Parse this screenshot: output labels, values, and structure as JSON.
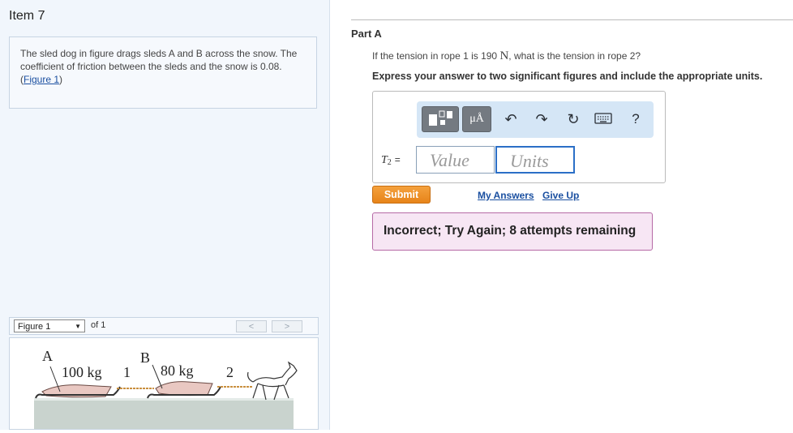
{
  "item": {
    "title": "Item 7"
  },
  "problem": {
    "text": "The sled dog in figure drags sleds A and B across the snow. The coefficient of friction between the sleds and the snow is 0.08.",
    "figure_link_open": "(",
    "figure_link": "Figure 1",
    "figure_link_close": ")"
  },
  "figure_nav": {
    "selected": "Figure 1",
    "of_label": "of 1",
    "prev": "<",
    "next": ">"
  },
  "figure": {
    "label_a": "A",
    "label_b": "B",
    "mass_a": "100 kg",
    "mass_b": "80 kg",
    "rope_1": "1",
    "rope_2": "2"
  },
  "part": {
    "label": "Part A",
    "question_pre": "If the tension in rope 1 is 190",
    "question_unit": "N",
    "question_post": ", what is the tension in rope 2?",
    "instruction": "Express your answer to two significant figures and include the appropriate units."
  },
  "answer": {
    "toolbar": {
      "templates_icon": "templates-icon",
      "units_symbol": "μÅ",
      "undo_icon": "undo-icon",
      "redo_icon": "redo-icon",
      "reset_icon": "reset-icon",
      "keyboard_icon": "keyboard-icon",
      "help_label": "?"
    },
    "var_main": "T",
    "var_sub": "2",
    "equals": "=",
    "value_placeholder": "Value",
    "units_placeholder": "Units"
  },
  "actions": {
    "submit": "Submit",
    "my_answers": "My Answers",
    "give_up": "Give Up"
  },
  "feedback": {
    "text": "Incorrect; Try Again; 8 attempts remaining"
  },
  "colors": {
    "left_panel_bg": "#f1f6fc",
    "submit_orange": "#f09a30",
    "link_blue": "#1a4fa0",
    "feedback_bg": "#f7e6f4",
    "feedback_border": "#b66aa6",
    "toolbar_bg": "#d5e6f6"
  }
}
